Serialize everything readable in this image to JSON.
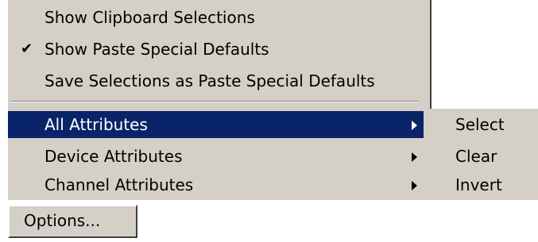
{
  "menu": {
    "items": [
      {
        "label": "Show Clipboard Selections",
        "checked": false
      },
      {
        "label": "Show Paste Special Defaults",
        "checked": true,
        "check_glyph": "✔"
      },
      {
        "label": "Save Selections as Paste Special Defaults",
        "checked": false
      },
      {
        "label": "All Attributes",
        "selected": true,
        "has_submenu": true
      },
      {
        "label": "Device Attributes",
        "has_submenu": true
      },
      {
        "label": "Channel Attributes",
        "has_submenu": true
      }
    ]
  },
  "submenu": {
    "items": [
      {
        "label": "Select"
      },
      {
        "label": "Clear"
      },
      {
        "label": "Invert"
      }
    ]
  },
  "options_button": {
    "label": "Options..."
  },
  "colors": {
    "menu_background": "#d4d0c8",
    "highlight": "#0a246a",
    "highlight_text": "#ffffff"
  },
  "icons": {
    "check": "check-icon",
    "submenu_arrow": "submenu-arrow-icon"
  }
}
